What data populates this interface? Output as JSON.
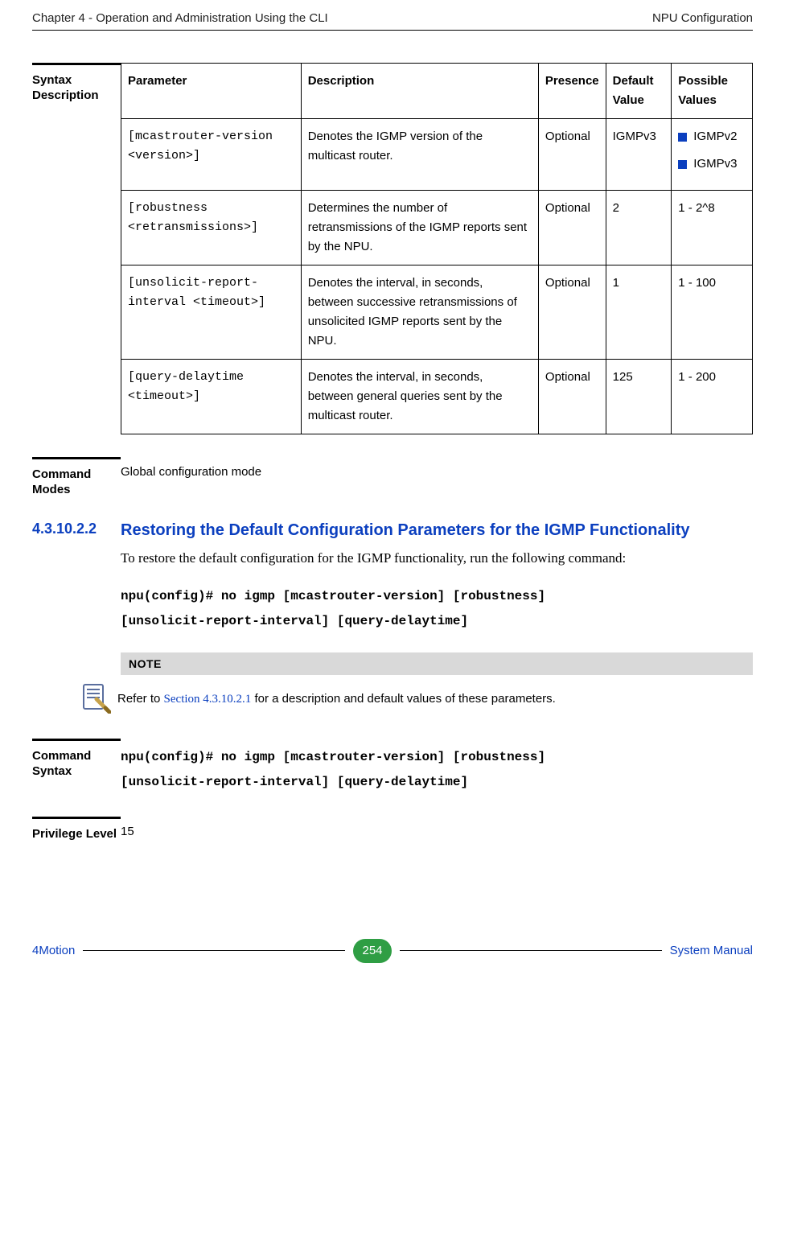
{
  "header": {
    "left": "Chapter 4 - Operation and Administration Using the CLI",
    "right": "NPU Configuration"
  },
  "syntaxDescription": {
    "label": "Syntax Description",
    "columns": [
      "Parameter",
      "Description",
      "Presence",
      "Default Value",
      "Possible Values"
    ],
    "rows": [
      {
        "param": "[mcastrouter-version <version>]",
        "desc": "Denotes the IGMP version of the multicast router.",
        "presence": "Optional",
        "default": "IGMPv3",
        "possible": [
          "IGMPv2",
          "IGMPv3"
        ]
      },
      {
        "param": "[robustness <retransmissions>]",
        "desc": "Determines the number of retransmissions of the IGMP reports sent by the NPU.",
        "presence": "Optional",
        "default": "2",
        "possible_text": "1 - 2^8"
      },
      {
        "param": "[unsolicit-report-interval <timeout>]",
        "desc": "Denotes the interval, in seconds, between successive retransmissions of unsolicited IGMP reports sent by the NPU.",
        "presence": "Optional",
        "default": "1",
        "possible_text": "1 - 100"
      },
      {
        "param": "[query-delaytime <timeout>]",
        "desc": "Denotes the interval, in seconds, between general queries sent by the multicast router.",
        "presence": "Optional",
        "default": "125",
        "possible_text": "1 - 200"
      }
    ]
  },
  "commandModes": {
    "label": "Command Modes",
    "value": "Global configuration mode"
  },
  "section": {
    "number": "4.3.10.2.2",
    "title": "Restoring the Default Configuration Parameters for the IGMP Functionality",
    "body": "To restore the default configuration for the IGMP functionality, run the following command:",
    "cmd_l1": "npu(config)# no igmp [mcastrouter-version] [robustness]",
    "cmd_l2": "[unsolicit-report-interval] [query-delaytime]"
  },
  "note": {
    "label": "NOTE",
    "pre": "Refer to ",
    "link": "Section 4.3.10.2.1",
    "post": " for a description and default values of these parameters."
  },
  "commandSyntax": {
    "label": "Command Syntax",
    "l1": "npu(config)# no igmp [mcastrouter-version] [robustness]",
    "l2": "[unsolicit-report-interval] [query-delaytime]"
  },
  "privilege": {
    "label": "Privilege Level",
    "value": "15"
  },
  "footer": {
    "left": "4Motion",
    "page": "254",
    "right": "System Manual"
  }
}
